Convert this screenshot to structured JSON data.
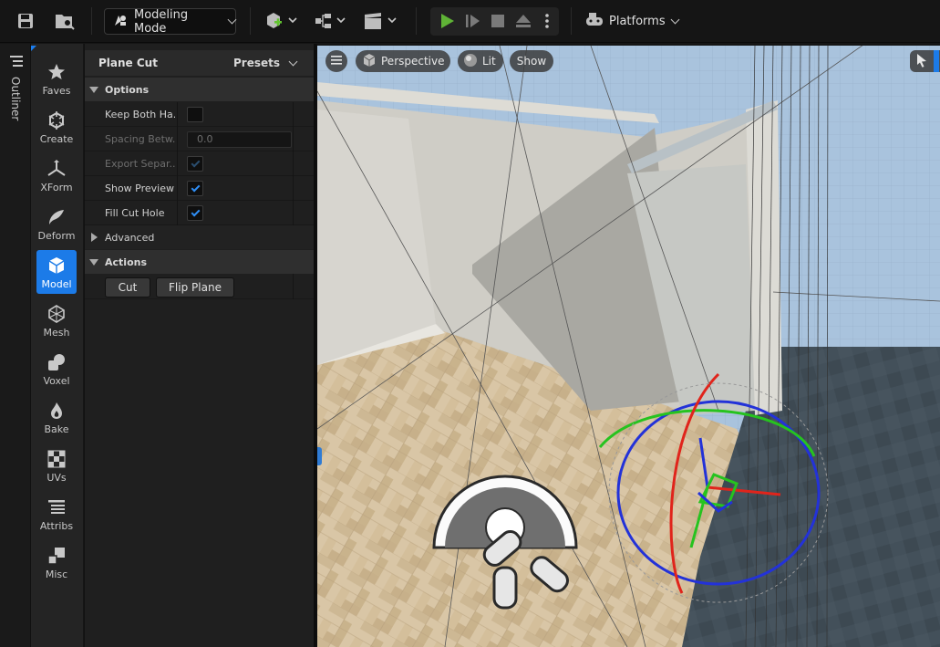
{
  "toolbar": {
    "mode_label": "Modeling Mode",
    "platforms_label": "Platforms",
    "icons": [
      "save-icon",
      "browse-icon",
      "add-actor-icon",
      "blueprint-icon",
      "cinematics-icon",
      "play-icon",
      "step-icon",
      "stop-icon",
      "eject-icon",
      "more-icon",
      "platforms-icon"
    ]
  },
  "outliner": {
    "label": "Outliner"
  },
  "categories": [
    {
      "label": "Faves",
      "icon": "star-icon"
    },
    {
      "label": "Create",
      "icon": "create-icon"
    },
    {
      "label": "XForm",
      "icon": "xform-icon"
    },
    {
      "label": "Deform",
      "icon": "deform-icon"
    },
    {
      "label": "Model",
      "icon": "model-icon",
      "active": true
    },
    {
      "label": "Mesh",
      "icon": "mesh-icon"
    },
    {
      "label": "Voxel",
      "icon": "voxel-icon"
    },
    {
      "label": "Bake",
      "icon": "bake-icon"
    },
    {
      "label": "UVs",
      "icon": "uvs-icon"
    },
    {
      "label": "Attribs",
      "icon": "attribs-icon"
    },
    {
      "label": "Misc",
      "icon": "misc-icon"
    }
  ],
  "panel": {
    "title": "Plane Cut",
    "presets_label": "Presets",
    "options_section": "Options",
    "rows": [
      {
        "label": "Keep Both Ha...",
        "type": "checkbox",
        "checked": false,
        "disabled": false
      },
      {
        "label": "Spacing Betw...",
        "type": "number",
        "value": "0.0",
        "disabled": true
      },
      {
        "label": "Export Separ...",
        "type": "checkbox",
        "checked": true,
        "disabled": true
      },
      {
        "label": "Show Preview",
        "type": "checkbox",
        "checked": true,
        "disabled": false
      },
      {
        "label": "Fill Cut Hole",
        "type": "checkbox",
        "checked": true,
        "disabled": false
      }
    ],
    "advanced_section": "Advanced",
    "actions_section": "Actions",
    "cut_label": "Cut",
    "flip_label": "Flip Plane"
  },
  "viewport": {
    "perspective_label": "Perspective",
    "lit_label": "Lit",
    "show_label": "Show"
  },
  "colors": {
    "accent": "#1c7be8",
    "check": "#2f8ef5",
    "play": "#5fb336"
  }
}
